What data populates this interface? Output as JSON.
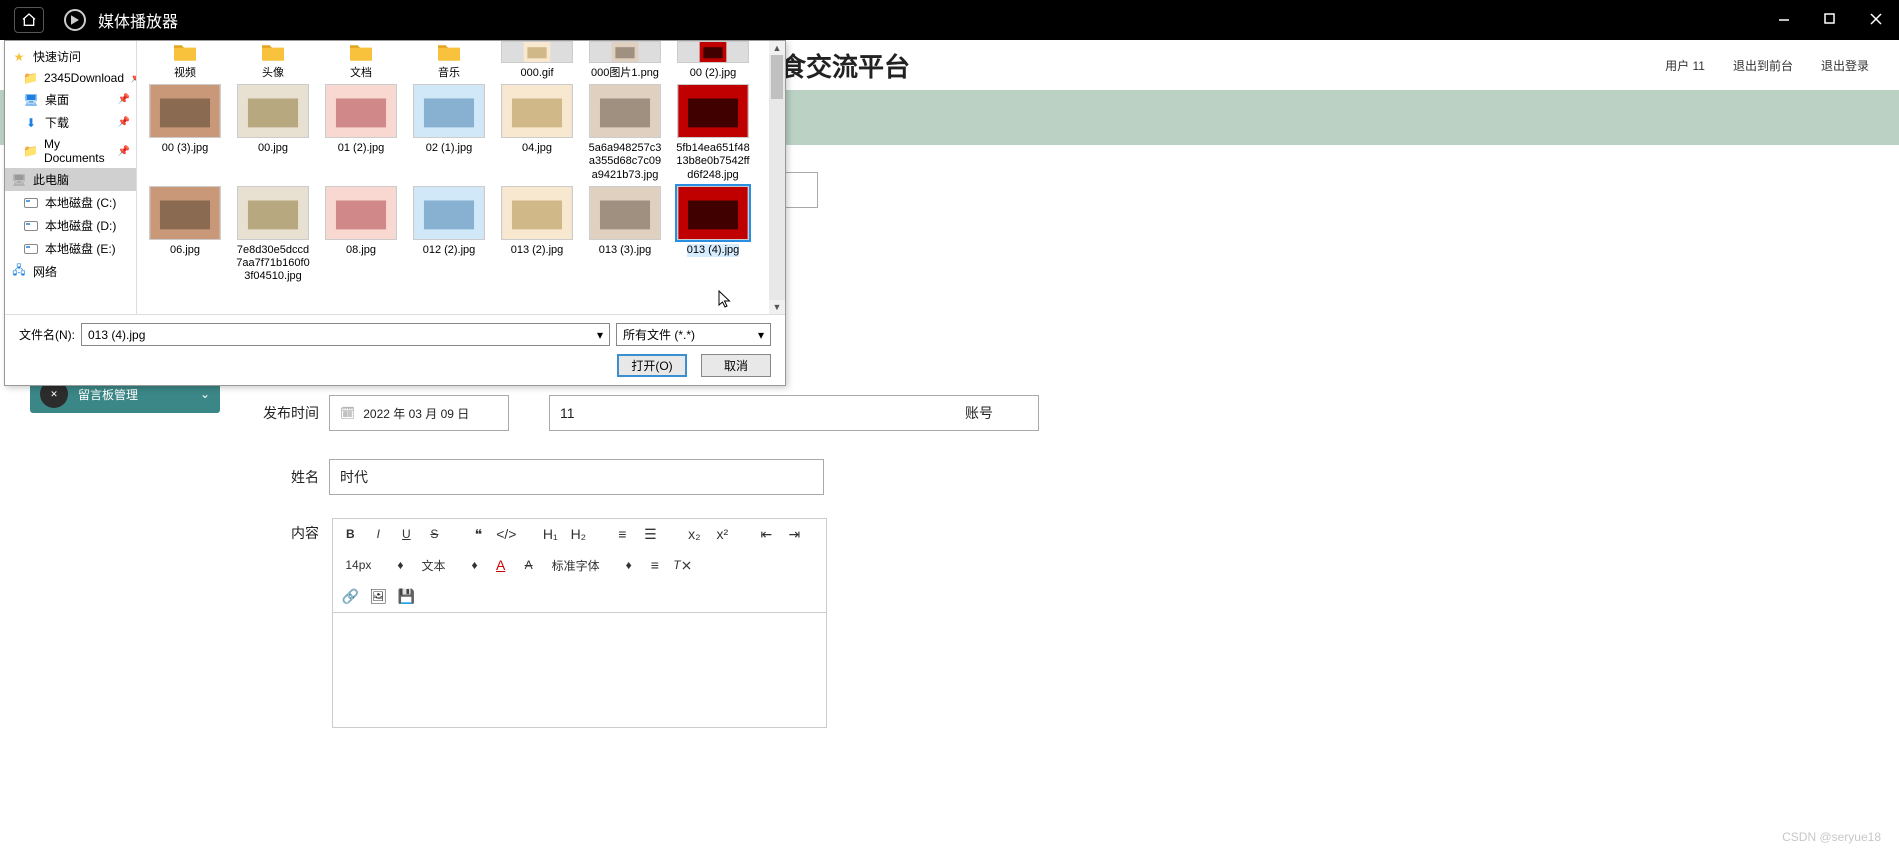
{
  "titlebar": {
    "app_title": "媒体播放器"
  },
  "header": {
    "page_title_fragment": "食交流平台",
    "user_label": "用户 11",
    "link_logout_front": "退出到前台",
    "link_logout": "退出登录"
  },
  "sidemenu": {
    "item_label": "留言板管理"
  },
  "form": {
    "publish_label": "发布时间",
    "publish_value": "2022 年 03 月 09 日",
    "account_label": "账号",
    "account_value": "11",
    "name_label": "姓名",
    "name_value": "时代",
    "content_label": "内容"
  },
  "editor": {
    "font_size": "14px",
    "text_menu": "文本",
    "font_family": "标准字体"
  },
  "file_dialog": {
    "sidebar": {
      "quick_access": "快速访问",
      "download2345": "2345Download",
      "desktop": "桌面",
      "downloads": "下载",
      "mydocs": "My Documents",
      "this_pc": "此电脑",
      "drive_c": "本地磁盘 (C:)",
      "drive_d": "本地磁盘 (D:)",
      "drive_e": "本地磁盘 (E:)",
      "network": "网络"
    },
    "items_row0": [
      {
        "name": "视频",
        "type": "folder"
      },
      {
        "name": "头像",
        "type": "folder"
      },
      {
        "name": "文档",
        "type": "folder"
      },
      {
        "name": "音乐",
        "type": "folder"
      },
      {
        "name": "000.gif",
        "type": "img"
      },
      {
        "name": "000图片1.png",
        "type": "img"
      },
      {
        "name": "00 (2).jpg",
        "type": "img"
      }
    ],
    "items_row1": [
      {
        "name": "00 (3).jpg"
      },
      {
        "name": "00.jpg"
      },
      {
        "name": "01 (2).jpg"
      },
      {
        "name": "02 (1).jpg"
      },
      {
        "name": "04.jpg"
      },
      {
        "name": "5a6a948257c3a355d68c7c09a9421b73.jpg"
      },
      {
        "name": "5fb14ea651f4813b8e0b7542ffd6f248.jpg"
      }
    ],
    "items_row2": [
      {
        "name": "06.jpg"
      },
      {
        "name": "7e8d30e5dccd7aa7f71b160f03f04510.jpg"
      },
      {
        "name": "08.jpg"
      },
      {
        "name": "012 (2).jpg"
      },
      {
        "name": "013 (2).jpg"
      },
      {
        "name": "013 (3).jpg"
      },
      {
        "name": "013 (4).jpg",
        "selected": true
      }
    ],
    "filename_label": "文件名(N):",
    "filename_value": "013 (4).jpg",
    "filter_value": "所有文件 (*.*)",
    "open_label": "打开(O)",
    "cancel_label": "取消"
  },
  "watermark": "CSDN @seryue18"
}
